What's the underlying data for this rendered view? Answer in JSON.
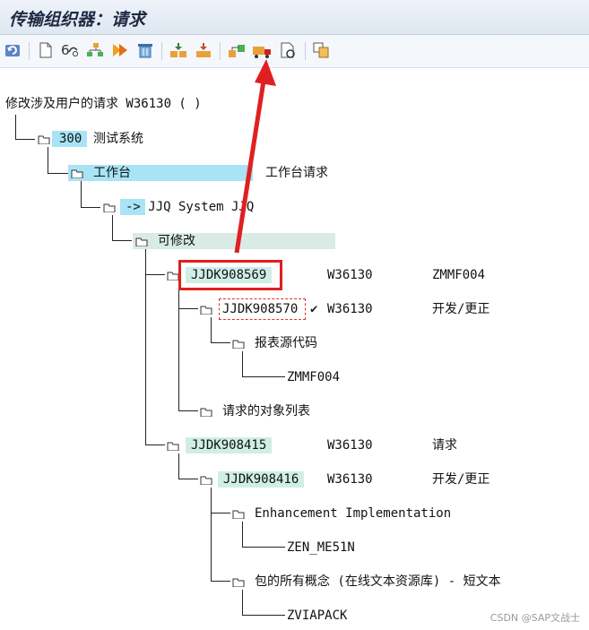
{
  "window": {
    "title": "传输组织器：请求"
  },
  "toolbar": {
    "buttons": [
      {
        "name": "refresh-icon"
      },
      {
        "name": "new-document-icon"
      },
      {
        "name": "display-change-icon"
      },
      {
        "name": "hierarchy-icon"
      },
      {
        "name": "activate-icon"
      },
      {
        "name": "delete-icon"
      },
      {
        "name": "release-icon"
      },
      {
        "name": "collapse-icon"
      },
      {
        "name": "transport-lock-icon"
      },
      {
        "name": "transport-truck-icon"
      },
      {
        "name": "check-objects-icon"
      },
      {
        "name": "copy-object-icon"
      }
    ]
  },
  "tree": {
    "root": "修改涉及用户的请求 W36130 ( )",
    "client_num": "300",
    "client_label": "测试系统",
    "workbench": "工作台",
    "workbench_desc": "工作台请求",
    "target": "-> JJQ System JJQ",
    "modifiable": "可修改",
    "req1": {
      "id": "JJDK908569",
      "owner": "W36130",
      "desc": "ZMMF004"
    },
    "task1": {
      "id": "JJDK908570",
      "check": "✔",
      "owner": "W36130",
      "desc": "开发/更正"
    },
    "task1_obj_group": "报表源代码",
    "task1_obj": "ZMMF004",
    "req1_objlist": "请求的对象列表",
    "req2": {
      "id": "JJDK908415",
      "owner": "W36130",
      "desc": "请求"
    },
    "task2": {
      "id": "JJDK908416",
      "owner": "W36130",
      "desc": "开发/更正"
    },
    "task2_group1": "Enhancement Implementation",
    "task2_obj1": "ZEN_ME51N",
    "task2_group2": "包的所有概念 (在线文本资源库) - 短文本",
    "task2_obj2": "ZVIAPACK"
  },
  "watermark": "CSDN @SAP文战士",
  "colors": {
    "highlight_blue": "#a8e4f6",
    "highlight_teal": "#cfeee5",
    "annotation_red": "#e02020"
  }
}
